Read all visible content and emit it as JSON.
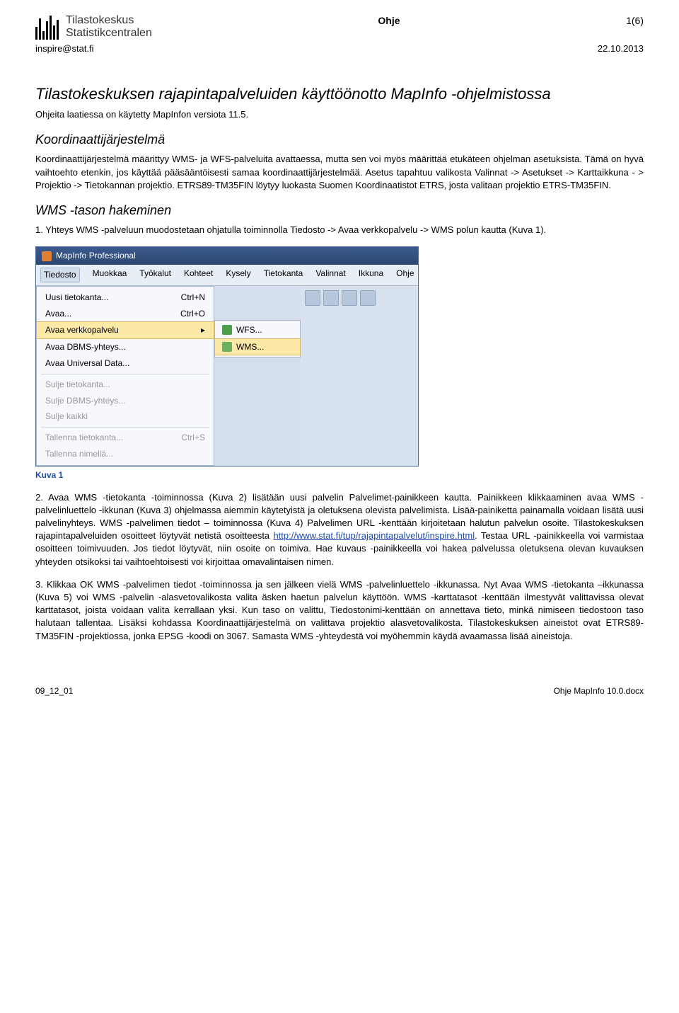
{
  "header": {
    "logo_line1": "Tilastokeskus",
    "logo_line2": "Statistikcentralen",
    "doc_type": "Ohje",
    "page_num": "1(6)",
    "email": "inspire@stat.fi",
    "date": "22.10.2013"
  },
  "title": "Tilastokeskuksen rajapintapalveluiden käyttöönotto MapInfo -ohjelmistossa",
  "subtitle": "Ohjeita laatiessa on käytetty MapInfon versiota 11.5.",
  "section_coord": {
    "heading": "Koordinaattijärjestelmä",
    "body": "Koordinaattijärjestelmä määrittyy WMS- ja WFS-palveluita avattaessa, mutta sen voi myös määrittää etukäteen ohjelman asetuksista. Tämä on hyvä vaihtoehto etenkin, jos käyttää pääsääntöisesti samaa koordinaattijärjestelmää. Asetus tapahtuu valikosta Valinnat -> Asetukset -> Karttaikkuna - > Projektio -> Tietokannan projektio. ETRS89-TM35FIN löytyy luokasta Suomen Koordinaatistot ETRS, josta valitaan projektio ETRS-TM35FIN."
  },
  "section_wms": {
    "heading": "WMS -tason hakeminen",
    "step1": "1. Yhteys WMS -palveluun muodostetaan ohjatulla toiminnolla Tiedosto -> Avaa verkkopalvelu -> WMS polun kautta (Kuva 1)."
  },
  "screenshot": {
    "title": "MapInfo Professional",
    "menu": [
      "Tiedosto",
      "Muokkaa",
      "Työkalut",
      "Kohteet",
      "Kysely",
      "Tietokanta",
      "Valinnat",
      "Ikkuna",
      "Ohje"
    ],
    "dropdown": [
      {
        "label": "Uusi tietokanta...",
        "accel": "Ctrl+N"
      },
      {
        "label": "Avaa...",
        "accel": "Ctrl+O"
      },
      {
        "label": "Avaa verkkopalvelu",
        "accel": "",
        "hl": true,
        "arrow": true
      },
      {
        "label": "Avaa DBMS-yhteys...",
        "accel": ""
      },
      {
        "label": "Avaa Universal Data...",
        "accel": ""
      },
      {
        "sep": true
      },
      {
        "label": "Sulje tietokanta...",
        "accel": "",
        "disabled": true
      },
      {
        "label": "Sulje DBMS-yhteys...",
        "accel": "",
        "disabled": true
      },
      {
        "label": "Sulje kaikki",
        "accel": "",
        "disabled": true
      },
      {
        "sep": true
      },
      {
        "label": "Tallenna tietokanta...",
        "accel": "Ctrl+S",
        "disabled": true
      },
      {
        "label": "Tallenna nimellä...",
        "accel": "",
        "disabled": true
      }
    ],
    "submenu": [
      {
        "label": "WFS..."
      },
      {
        "label": "WMS...",
        "hl": true
      }
    ]
  },
  "caption1": "Kuva 1",
  "para2_a": "2. Avaa WMS -tietokanta -toiminnossa (Kuva 2) lisätään uusi palvelin Palvelimet-painikkeen kautta. Painikkeen klikkaaminen avaa WMS -palvelinluettelo -ikkunan (Kuva 3) ohjelmassa aiemmin käytetyistä ja oletuksena olevista palvelimista. Lisää-painiketta painamalla voidaan lisätä uusi palvelinyhteys. WMS -palvelimen tiedot – toiminnossa (Kuva 4)  Palvelimen URL -kenttään kirjoitetaan halutun palvelun osoite. Tilastokeskuksen rajapintapalveluiden osoitteet löytyvät netistä osoitteesta ",
  "link_text": "http://www.stat.fi/tup/rajapintapalvelut/inspire.html",
  "para2_b": ". Testaa URL -painikkeella voi varmistaa osoitteen toimivuuden. Jos tiedot löytyvät, niin osoite on toimiva. Hae kuvaus -painikkeella voi hakea palvelussa oletuksena olevan kuvauksen yhteyden otsikoksi tai vaihtoehtoisesti voi kirjoittaa omavalintaisen nimen.",
  "para3": "3. Klikkaa OK WMS -palvelimen tiedot -toiminnossa ja sen jälkeen vielä WMS -palvelinluettelo -ikkunassa. Nyt Avaa WMS -tietokanta –ikkunassa (Kuva 5) voi WMS -palvelin -alasvetovalikosta valita äsken haetun palvelun käyttöön. WMS -karttatasot -kenttään ilmestyvät valittavissa olevat karttatasot, joista voidaan valita kerrallaan yksi. Kun taso on valittu, Tiedostonimi-kenttään on annettava tieto, minkä nimiseen tiedostoon taso halutaan tallentaa. Lisäksi kohdassa Koordinaattijärjestelmä on valittava projektio alasvetovalikosta. Tilastokeskuksen aineistot ovat ETRS89-TM35FIN -projektiossa, jonka EPSG -koodi on 3067. Samasta WMS -yhteydestä voi myöhemmin käydä avaamassa lisää aineistoja.",
  "footer": {
    "left": "09_12_01",
    "right": "Ohje MapInfo 10.0.docx"
  }
}
